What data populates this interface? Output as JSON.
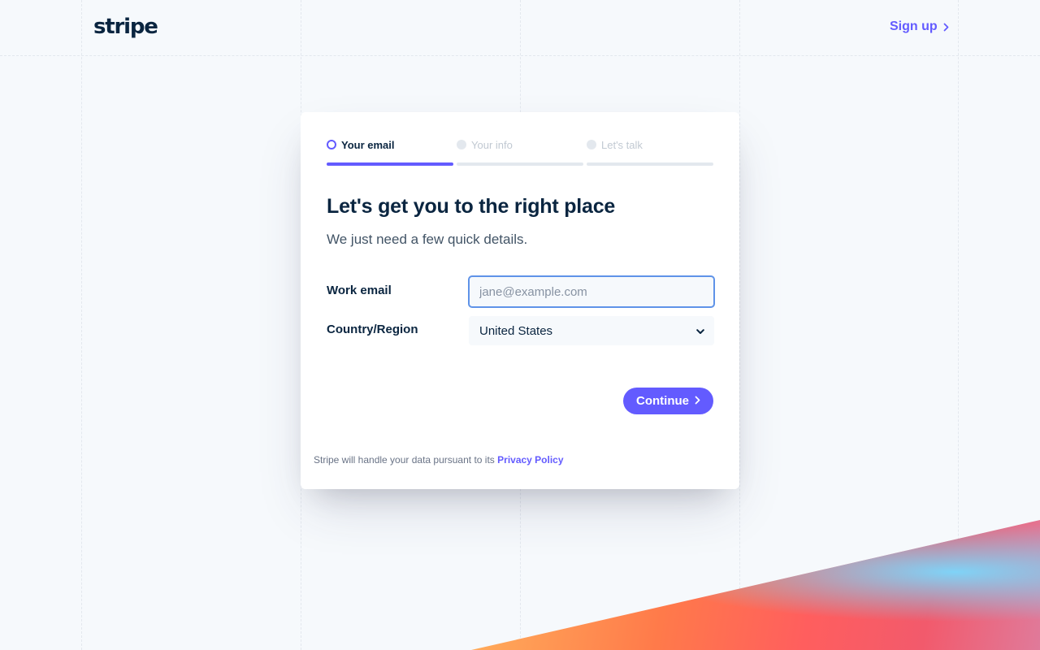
{
  "header": {
    "logo_text": "stripe",
    "signup_label": "Sign up"
  },
  "steps": [
    {
      "label": "Your email",
      "state": "active"
    },
    {
      "label": "Your info",
      "state": "inactive"
    },
    {
      "label": "Let's talk",
      "state": "inactive"
    }
  ],
  "form": {
    "title": "Let's get you to the right place",
    "subtitle": "We just need a few quick details.",
    "email_label": "Work email",
    "email_placeholder": "jane@example.com",
    "email_value": "",
    "country_label": "Country/Region",
    "country_value": "United States",
    "continue_label": "Continue"
  },
  "footer": {
    "notice_text": "Stripe will handle your data pursuant to its",
    "privacy_link": "Privacy Policy"
  },
  "colors": {
    "accent": "#635bff",
    "text": "#0a2540",
    "muted": "#c1c9d2",
    "focus_border": "#5f93e8"
  }
}
